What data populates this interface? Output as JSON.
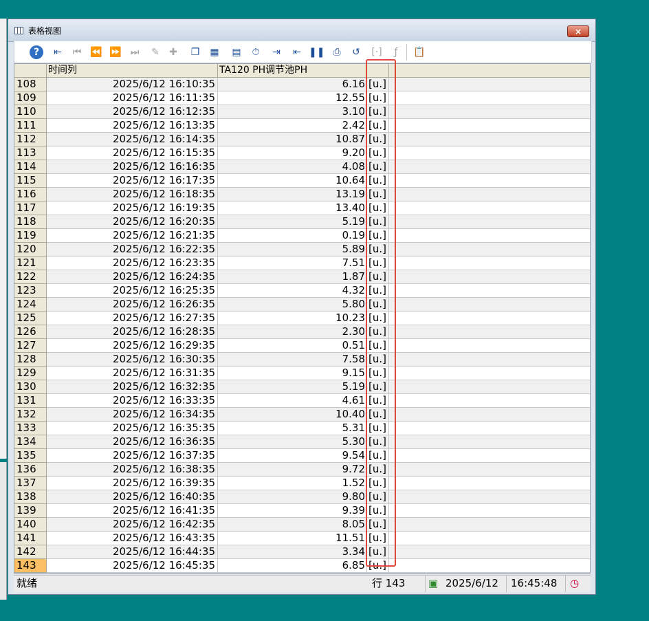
{
  "window": {
    "title": "表格视图",
    "close_label": "×"
  },
  "toolbar": {
    "buttons": [
      {
        "icon": "help-icon",
        "glyph": "?"
      },
      {
        "icon": "export-icon",
        "glyph": "⇤"
      },
      {
        "icon": "first-record-icon",
        "glyph": "⏮"
      },
      {
        "icon": "prev-record-icon",
        "glyph": "⏪"
      },
      {
        "icon": "next-record-icon",
        "glyph": "⏩"
      },
      {
        "icon": "last-record-icon",
        "glyph": "⏭"
      },
      {
        "icon": "edit-pen-icon",
        "glyph": "✎"
      },
      {
        "icon": "add-pen-icon",
        "glyph": "✚"
      },
      {
        "icon": "copy-icon",
        "glyph": "❐"
      },
      {
        "icon": "columns-icon",
        "glyph": "▦"
      },
      {
        "icon": "table-config-icon",
        "glyph": "▤"
      },
      {
        "icon": "timer-icon",
        "glyph": "⏱"
      },
      {
        "icon": "start-time-icon",
        "glyph": "⇥"
      },
      {
        "icon": "end-time-icon",
        "glyph": "⇤"
      },
      {
        "icon": "pause-icon",
        "glyph": "❚❚"
      },
      {
        "icon": "print-icon",
        "glyph": "⎙"
      },
      {
        "icon": "refresh-icon",
        "glyph": "↺"
      },
      {
        "icon": "cut-range-icon",
        "glyph": "[·]"
      },
      {
        "icon": "function-icon",
        "glyph": "ƒ"
      },
      {
        "icon": "report-icon",
        "glyph": "📋"
      }
    ]
  },
  "table": {
    "headers": [
      "时间列",
      "TA120 PH调节池PH"
    ],
    "rows": [
      {
        "idx": "108",
        "time": "2025/6/12 16:10:35",
        "value": "6.16",
        "unit": "[u.]"
      },
      {
        "idx": "109",
        "time": "2025/6/12 16:11:35",
        "value": "12.55",
        "unit": "[u.]"
      },
      {
        "idx": "110",
        "time": "2025/6/12 16:12:35",
        "value": "3.10",
        "unit": "[u.]"
      },
      {
        "idx": "111",
        "time": "2025/6/12 16:13:35",
        "value": "2.42",
        "unit": "[u.]"
      },
      {
        "idx": "112",
        "time": "2025/6/12 16:14:35",
        "value": "10.87",
        "unit": "[u.]"
      },
      {
        "idx": "113",
        "time": "2025/6/12 16:15:35",
        "value": "9.20",
        "unit": "[u.]"
      },
      {
        "idx": "114",
        "time": "2025/6/12 16:16:35",
        "value": "4.08",
        "unit": "[u.]"
      },
      {
        "idx": "115",
        "time": "2025/6/12 16:17:35",
        "value": "10.64",
        "unit": "[u.]"
      },
      {
        "idx": "116",
        "time": "2025/6/12 16:18:35",
        "value": "13.19",
        "unit": "[u.]"
      },
      {
        "idx": "117",
        "time": "2025/6/12 16:19:35",
        "value": "13.40",
        "unit": "[u.]"
      },
      {
        "idx": "118",
        "time": "2025/6/12 16:20:35",
        "value": "5.19",
        "unit": "[u.]"
      },
      {
        "idx": "119",
        "time": "2025/6/12 16:21:35",
        "value": "0.19",
        "unit": "[u.]"
      },
      {
        "idx": "120",
        "time": "2025/6/12 16:22:35",
        "value": "5.89",
        "unit": "[u.]"
      },
      {
        "idx": "121",
        "time": "2025/6/12 16:23:35",
        "value": "7.51",
        "unit": "[u.]"
      },
      {
        "idx": "122",
        "time": "2025/6/12 16:24:35",
        "value": "1.87",
        "unit": "[u.]"
      },
      {
        "idx": "123",
        "time": "2025/6/12 16:25:35",
        "value": "4.32",
        "unit": "[u.]"
      },
      {
        "idx": "124",
        "time": "2025/6/12 16:26:35",
        "value": "5.80",
        "unit": "[u.]"
      },
      {
        "idx": "125",
        "time": "2025/6/12 16:27:35",
        "value": "10.23",
        "unit": "[u.]"
      },
      {
        "idx": "126",
        "time": "2025/6/12 16:28:35",
        "value": "2.30",
        "unit": "[u.]"
      },
      {
        "idx": "127",
        "time": "2025/6/12 16:29:35",
        "value": "0.51",
        "unit": "[u.]"
      },
      {
        "idx": "128",
        "time": "2025/6/12 16:30:35",
        "value": "7.58",
        "unit": "[u.]"
      },
      {
        "idx": "129",
        "time": "2025/6/12 16:31:35",
        "value": "9.15",
        "unit": "[u.]"
      },
      {
        "idx": "130",
        "time": "2025/6/12 16:32:35",
        "value": "5.19",
        "unit": "[u.]"
      },
      {
        "idx": "131",
        "time": "2025/6/12 16:33:35",
        "value": "4.61",
        "unit": "[u.]"
      },
      {
        "idx": "132",
        "time": "2025/6/12 16:34:35",
        "value": "10.40",
        "unit": "[u.]"
      },
      {
        "idx": "133",
        "time": "2025/6/12 16:35:35",
        "value": "5.31",
        "unit": "[u.]"
      },
      {
        "idx": "134",
        "time": "2025/6/12 16:36:35",
        "value": "5.30",
        "unit": "[u.]"
      },
      {
        "idx": "135",
        "time": "2025/6/12 16:37:35",
        "value": "9.54",
        "unit": "[u.]"
      },
      {
        "idx": "136",
        "time": "2025/6/12 16:38:35",
        "value": "9.72",
        "unit": "[u.]"
      },
      {
        "idx": "137",
        "time": "2025/6/12 16:39:35",
        "value": "1.52",
        "unit": "[u.]"
      },
      {
        "idx": "138",
        "time": "2025/6/12 16:40:35",
        "value": "9.80",
        "unit": "[u.]"
      },
      {
        "idx": "139",
        "time": "2025/6/12 16:41:35",
        "value": "9.39",
        "unit": "[u.]"
      },
      {
        "idx": "140",
        "time": "2025/6/12 16:42:35",
        "value": "8.05",
        "unit": "[u.]"
      },
      {
        "idx": "141",
        "time": "2025/6/12 16:43:35",
        "value": "11.51",
        "unit": "[u.]"
      },
      {
        "idx": "142",
        "time": "2025/6/12 16:44:35",
        "value": "3.34",
        "unit": "[u.]"
      },
      {
        "idx": "143",
        "time": "2025/6/12 16:45:35",
        "value": "6.85",
        "unit": "[u.]",
        "selected": true
      }
    ]
  },
  "status": {
    "ready": "就绪",
    "row_label": "行 143",
    "date": "2025/6/12",
    "time": "16:45:48"
  },
  "colors": {
    "highlight_box": "#e0483b",
    "selected_row": "#fbbf63",
    "background": "#008080"
  }
}
